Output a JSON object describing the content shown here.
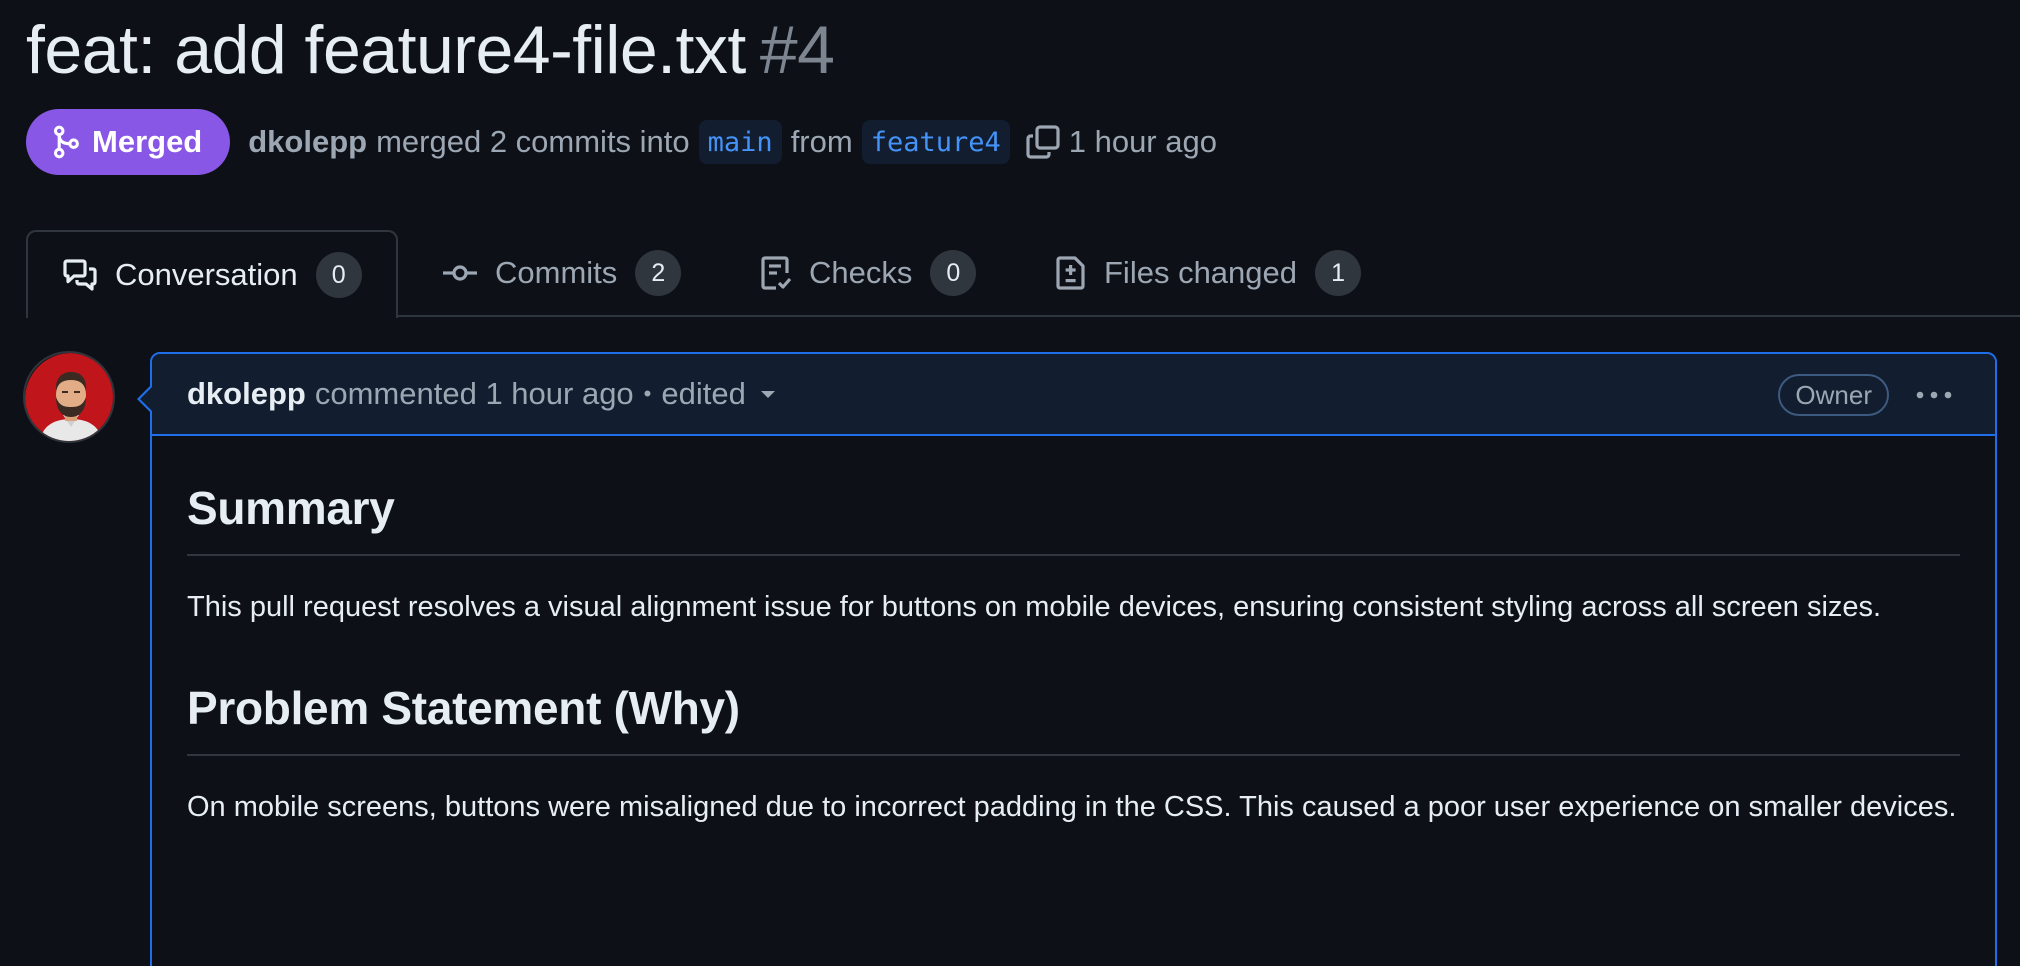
{
  "pr": {
    "title": "feat: add feature4-file.txt",
    "number": "#4",
    "status_label": "Merged",
    "author": "dkolepp",
    "action_text": "merged 2 commits into",
    "base_branch": "main",
    "from_text": "from",
    "head_branch": "feature4",
    "time": "1 hour ago"
  },
  "tabs": [
    {
      "label": "Conversation",
      "count": "0",
      "icon": "comment-discussion-icon",
      "active": true
    },
    {
      "label": "Commits",
      "count": "2",
      "icon": "git-commit-icon",
      "active": false
    },
    {
      "label": "Checks",
      "count": "0",
      "icon": "checklist-icon",
      "active": false
    },
    {
      "label": "Files changed",
      "count": "1",
      "icon": "file-diff-icon",
      "active": false
    }
  ],
  "comment": {
    "author": "dkolepp",
    "action": "commented",
    "time": "1 hour ago",
    "separator": "•",
    "edited": "edited",
    "role_badge": "Owner",
    "sections": [
      {
        "heading": "Summary",
        "text": "This pull request resolves a visual alignment issue for buttons on mobile devices, ensuring consistent styling across all screen sizes."
      },
      {
        "heading": "Problem Statement (Why)",
        "text": "On mobile screens, buttons were misaligned due to incorrect padding in the CSS. This caused a poor user experience on smaller devices."
      }
    ]
  },
  "colors": {
    "background": "#0d1117",
    "merged_purple": "#8957e5",
    "branch_blue": "#4493f8",
    "comment_border": "#1f6feb",
    "comment_header_bg": "#121d2f",
    "muted_text": "#9da7b3"
  }
}
